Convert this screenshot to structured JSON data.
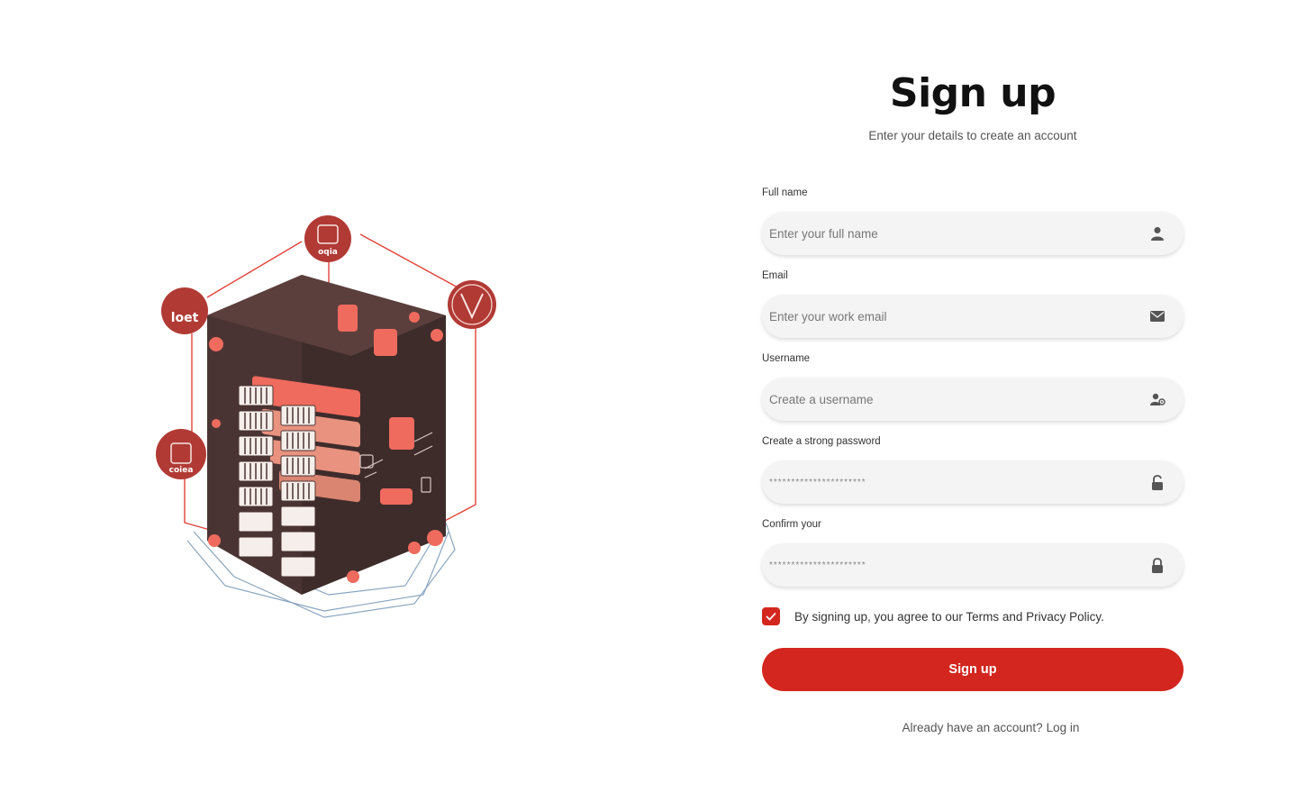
{
  "colors": {
    "accent": "#d3261e",
    "field_bg": "#f4f4f4",
    "illustration_dark": "#4a3433",
    "illustration_light": "#ef6b5e"
  },
  "illustration": {
    "name": "server-rack-illustration"
  },
  "header": {
    "title": "Sign up",
    "subtitle": "Enter your details to create an account"
  },
  "form": {
    "full_name": {
      "label": "Full name",
      "placeholder": "Enter your full name",
      "icon": "user-icon"
    },
    "email": {
      "label": "Email",
      "placeholder": "Enter your work email",
      "icon": "envelope-icon"
    },
    "username": {
      "label": "Username",
      "placeholder": "Create a username",
      "icon": "user-settings-icon"
    },
    "password": {
      "label": "Create a strong password",
      "placeholder": "**********************",
      "icon": "unlock-icon"
    },
    "confirm": {
      "label": "Confirm your",
      "placeholder": "**********************",
      "icon": "lock-icon"
    },
    "agree": {
      "checked": true,
      "text": "By signing up, you agree to our Terms and Privacy Policy."
    },
    "submit_label": "Sign up"
  },
  "footer": {
    "question": "Already have an account?",
    "link": "Log in"
  }
}
